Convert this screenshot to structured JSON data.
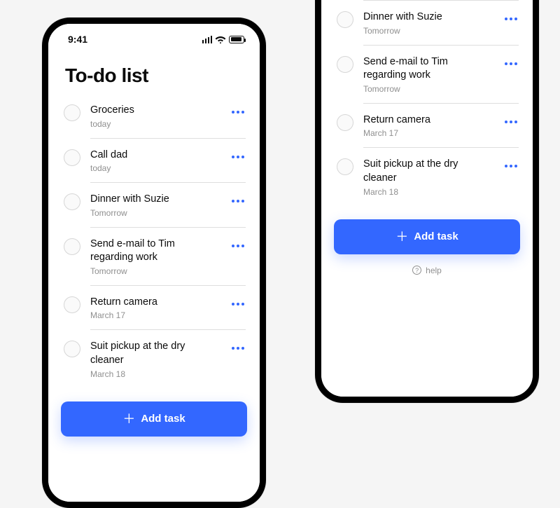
{
  "status": {
    "time": "9:41"
  },
  "title": "To-do list",
  "tasks": [
    {
      "title": "Groceries",
      "due": "today"
    },
    {
      "title": "Call dad",
      "due": "today"
    },
    {
      "title": "Dinner with Suzie",
      "due": "Tomorrow"
    },
    {
      "title": "Send e-mail to Tim regarding work",
      "due": "Tomorrow"
    },
    {
      "title": "Return camera",
      "due": "March 17"
    },
    {
      "title": "Suit pickup at the dry cleaner",
      "due": "March 18"
    }
  ],
  "add_button": "Add task",
  "help_label": "help",
  "colors": {
    "accent": "#3367ff"
  }
}
